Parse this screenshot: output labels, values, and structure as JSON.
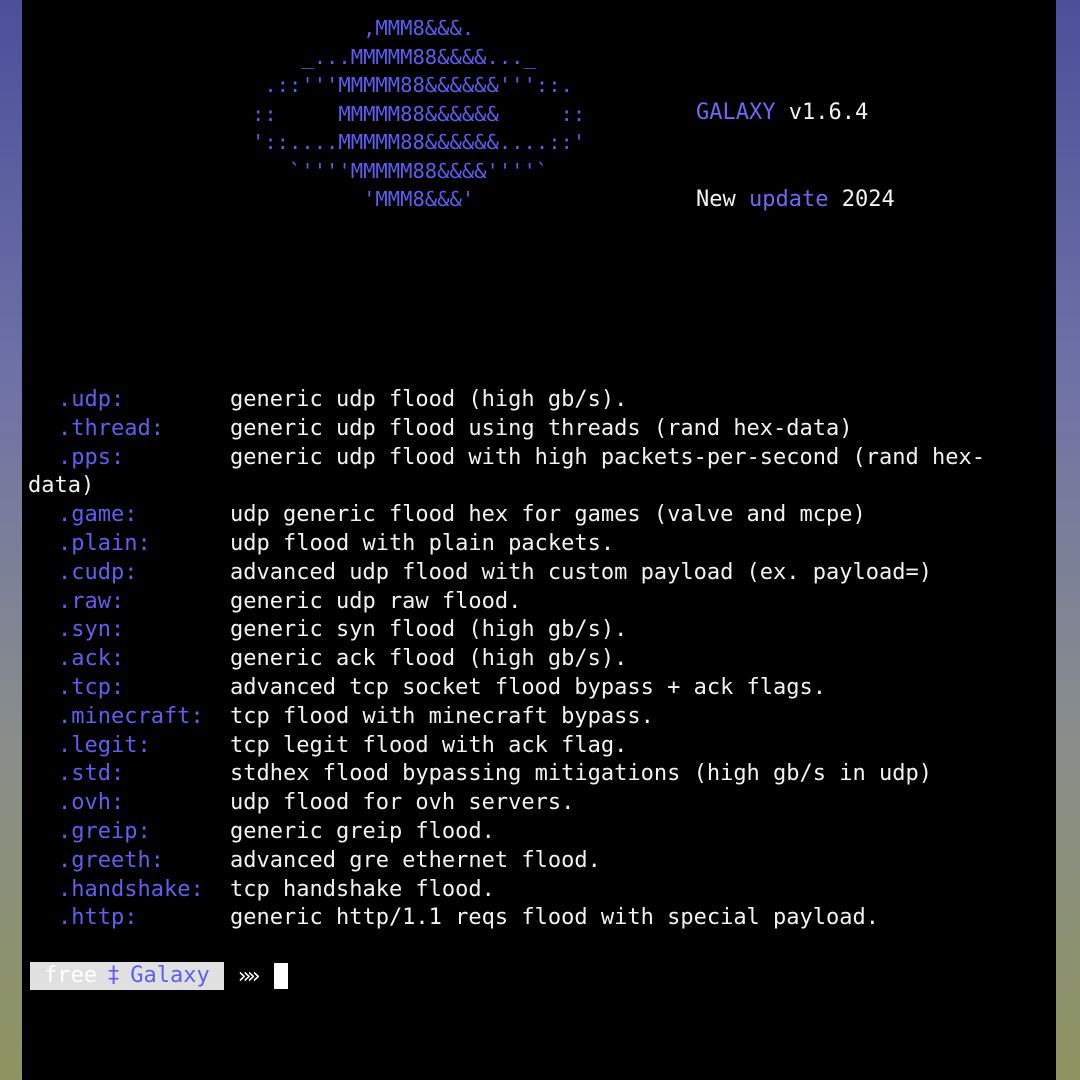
{
  "banner": {
    "art_lines": [
      "         ,MMM8&&&.",
      "    _...MMMMM88&&&&..._",
      " .::'''MMMMM88&&&&&&'''::.",
      "::     MMMMM88&&&&&&     ::",
      "'::....MMMMM88&&&&&&....::'",
      "   `''''MMMMM88&&&&''''`",
      "         'MMM8&&&'"
    ],
    "brand": "GALAXY",
    "version": "v1.6.4",
    "update_word1": "New",
    "update_word2": "update",
    "update_year": "2024"
  },
  "methods": [
    {
      "name": ".udp:",
      "desc": "generic udp flood (high gb/s)."
    },
    {
      "name": ".thread:",
      "desc": "generic udp flood using threads (rand hex-data)"
    },
    {
      "name": ".pps:",
      "desc": "generic udp flood with high packets-per-second (rand hex-",
      "wrap": "data)"
    },
    {
      "name": ".game:",
      "desc": "udp generic flood hex for games (valve and mcpe)"
    },
    {
      "name": ".plain:",
      "desc": "udp flood with plain packets."
    },
    {
      "name": ".cudp:",
      "desc": "advanced udp flood with custom payload (ex. payload=)"
    },
    {
      "name": ".raw:",
      "desc": "generic udp raw flood."
    },
    {
      "name": ".syn:",
      "desc": "generic syn flood (high gb/s)."
    },
    {
      "name": ".ack:",
      "desc": "generic ack flood (high gb/s)."
    },
    {
      "name": ".tcp:",
      "desc": "advanced tcp socket flood bypass + ack flags."
    },
    {
      "name": ".minecraft:",
      "desc": "tcp flood with minecraft bypass."
    },
    {
      "name": ".legit:",
      "desc": "tcp legit flood with ack flag."
    },
    {
      "name": ".std:",
      "desc": "stdhex flood bypassing mitigations (high gb/s in udp)"
    },
    {
      "name": ".ovh:",
      "desc": "udp flood for ovh servers."
    },
    {
      "name": ".greip:",
      "desc": "generic greip flood."
    },
    {
      "name": ".greeth:",
      "desc": "advanced gre ethernet flood."
    },
    {
      "name": ".handshake:",
      "desc": "tcp handshake flood."
    },
    {
      "name": ".http:",
      "desc": "generic http/1.1 reqs flood with special payload."
    }
  ],
  "prompt": {
    "user": "free",
    "separator": "‡",
    "host": "Galaxy",
    "arrow": "»"
  },
  "colors": {
    "accent": "#5e5ef0",
    "text": "#f2f2f2",
    "background": "#000000"
  }
}
